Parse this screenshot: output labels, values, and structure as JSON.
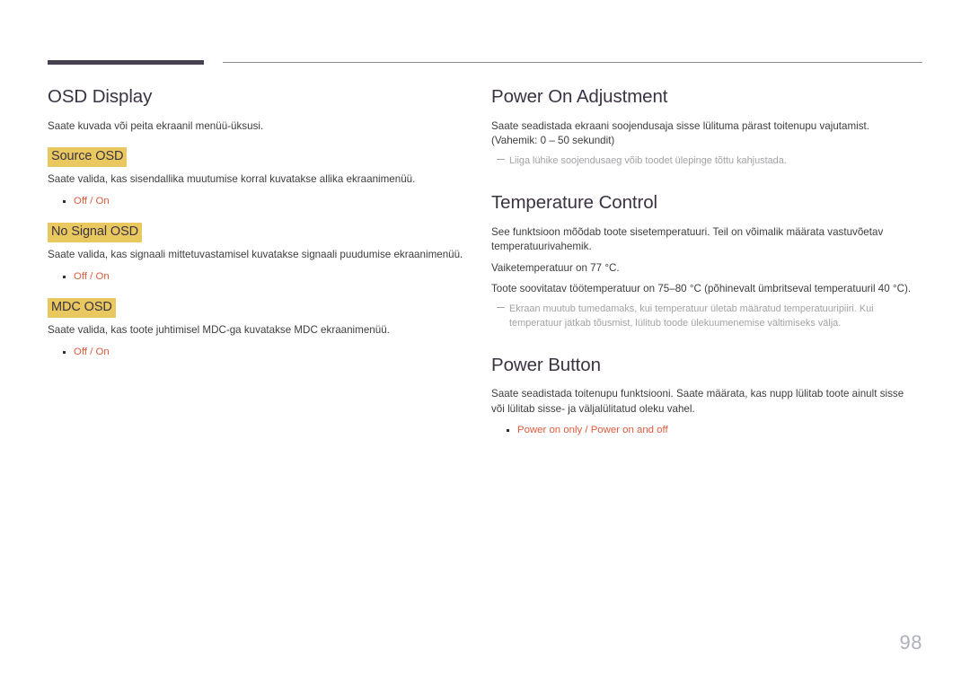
{
  "document": {
    "page_number": "98",
    "accent_highlight": "#e9c95f",
    "accent_option": "#de5b3c",
    "heading_color": "#3b3342",
    "rule_color": "#47414f"
  },
  "left_column": {
    "section_title": "OSD Display",
    "intro": "Saate kuvada või peita ekraanil menüü-üksusi.",
    "subsections": [
      {
        "title": "Source OSD",
        "body": "Saate valida, kas sisendallika muutumise korral kuvatakse allika ekraanimenüü.",
        "options": [
          "Off",
          "On"
        ],
        "separator": "/"
      },
      {
        "title": "No Signal OSD",
        "body": "Saate valida, kas signaali mittetuvastamisel kuvatakse signaali puudumise ekraanimenüü.",
        "options": [
          "Off",
          "On"
        ],
        "separator": "/"
      },
      {
        "title": "MDC OSD",
        "body": "Saate valida, kas toote juhtimisel MDC-ga kuvatakse MDC ekraanimenüü.",
        "options": [
          "Off",
          "On"
        ],
        "separator": "/"
      }
    ]
  },
  "right_column": {
    "sections": [
      {
        "title": "Power On Adjustment",
        "body": "Saate seadistada ekraani soojendusaja sisse lülituma pärast toitenupu vajutamist. (Vahemik: 0 – 50 sekundit)",
        "note": "Liiga lühike soojendusaeg võib toodet ülepinge tõttu kahjustada."
      },
      {
        "title": "Temperature Control",
        "body1": "See funktsioon mõõdab toote sisetemperatuuri. Teil on võimalik määrata vastuvõetav temperatuurivahemik.",
        "body2": "Vaiketemperatuur on 77 °C.",
        "body3": "Toote soovitatav töötemperatuur on 75–80 °C (põhinevalt ümbritseval temperatuuril 40 °C).",
        "note": "Ekraan muutub tumedamaks, kui temperatuur ületab määratud temperatuuripiiri. Kui temperatuur jätkab tõusmist, lülitub toode ülekuumenemise vältimiseks välja."
      },
      {
        "title": "Power Button",
        "body": "Saate seadistada toitenupu funktsiooni. Saate määrata, kas nupp lülitab toote ainult sisse või lülitab sisse- ja väljalülitatud oleku vahel.",
        "options": [
          "Power on only",
          "Power on and off"
        ],
        "separator": "/"
      }
    ]
  }
}
